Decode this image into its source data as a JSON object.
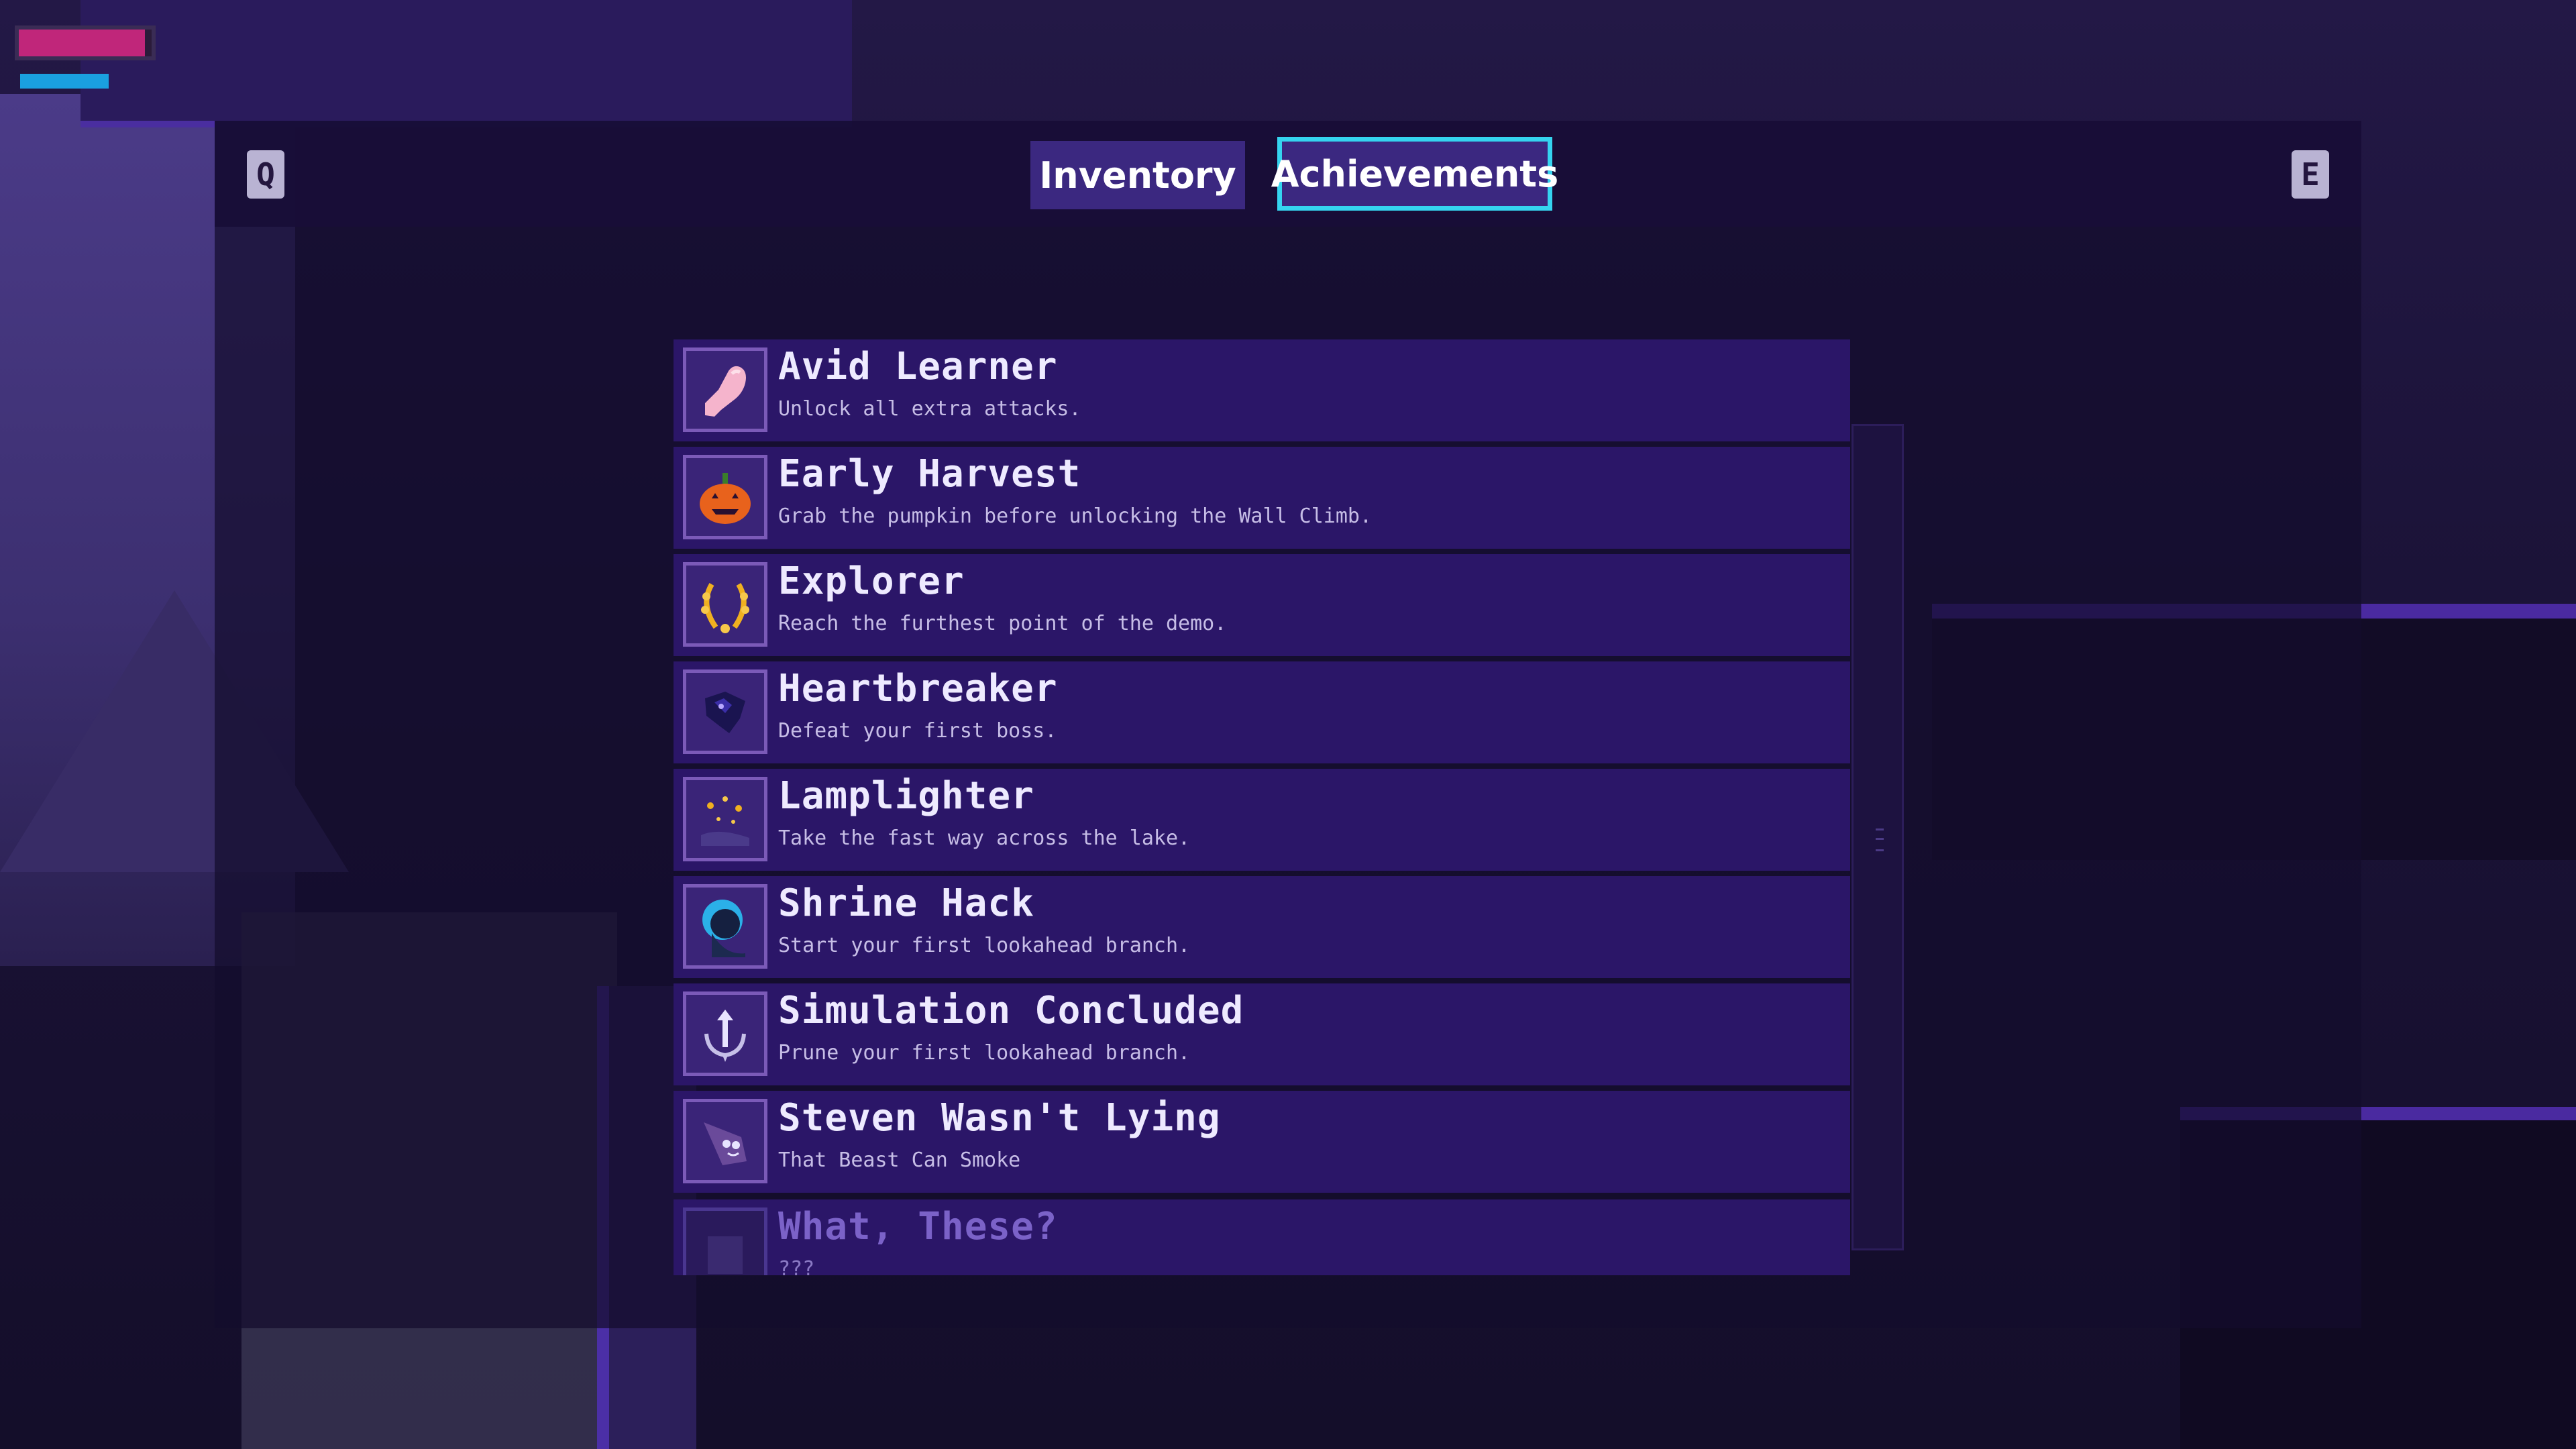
{
  "hud": {
    "health_fraction": 0.95,
    "energy_fraction": 0.6,
    "colors": {
      "health": "#c0267a",
      "energy": "#1aa0e0"
    }
  },
  "menu": {
    "prev_key": "Q",
    "next_key": "E",
    "tabs": [
      {
        "label": "Inventory",
        "active": false
      },
      {
        "label": "Achievements",
        "active": true
      }
    ],
    "accent": "#35d4ef"
  },
  "achievements": [
    {
      "title": "Avid Learner",
      "description": "Unlock all extra attacks.",
      "icon": "arm-icon",
      "locked": false
    },
    {
      "title": "Early Harvest",
      "description": "Grab the pumpkin before unlocking the Wall Climb.",
      "icon": "pumpkin-icon",
      "locked": false
    },
    {
      "title": "Explorer",
      "description": "Reach the furthest point of the demo.",
      "icon": "laurel-wreath-icon",
      "locked": false
    },
    {
      "title": "Heartbreaker",
      "description": "Defeat your first boss.",
      "icon": "dark-creature-icon",
      "locked": false
    },
    {
      "title": "Lamplighter",
      "description": "Take the fast way across the lake.",
      "icon": "sparks-icon",
      "locked": false
    },
    {
      "title": "Shrine Hack",
      "description": "Start your first lookahead branch.",
      "icon": "hooded-figure-icon",
      "locked": false
    },
    {
      "title": "Simulation Concluded",
      "description": "Prune your first lookahead branch.",
      "icon": "branch-arrow-icon",
      "locked": false
    },
    {
      "title": "Steven Wasn't Lying",
      "description": "That Beast Can Smoke",
      "icon": "beast-icon",
      "locked": false
    },
    {
      "title": "What, These?",
      "description": "???",
      "icon": "locked-icon",
      "locked": true
    }
  ]
}
